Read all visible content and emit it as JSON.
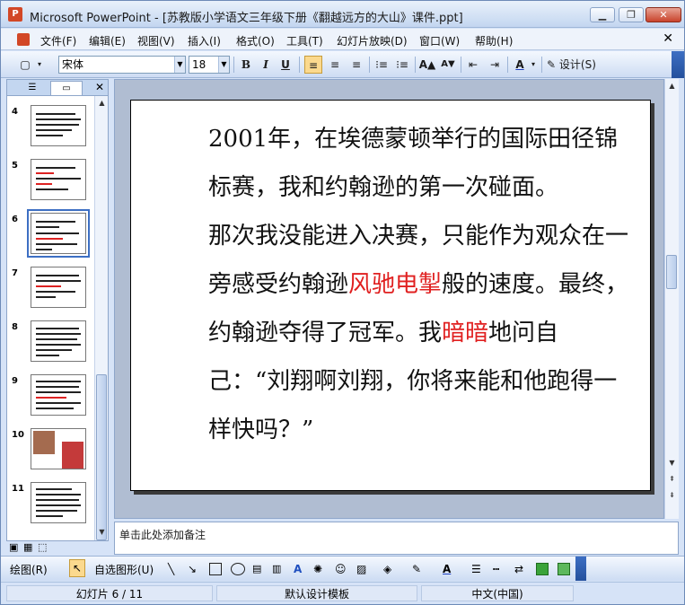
{
  "window": {
    "title": "Microsoft PowerPoint - [苏教版小学语文三年级下册《翻越远方的大山》课件.ppt]"
  },
  "menu": [
    "文件(F)",
    "编辑(E)",
    "视图(V)",
    "插入(I)",
    "格式(O)",
    "工具(T)",
    "幻灯片放映(D)",
    "窗口(W)",
    "帮助(H)"
  ],
  "toolbar": {
    "font": "宋体",
    "size": "18",
    "bold": "B",
    "italic": "I",
    "underline": "U",
    "font_color": "A",
    "design": "设计(S)"
  },
  "thumbnails": [
    "4",
    "5",
    "6",
    "7",
    "8",
    "9",
    "10",
    "11"
  ],
  "slide": {
    "p1": "2001年，在埃德蒙顿举行的国际田径锦标赛，我和约翰逊的第一次碰面。",
    "p2_a": "那次我没能进入决赛，只能作为观众在一旁感受约翰逊",
    "p2_hl1": "风驰电掣",
    "p2_b": "般的速度。最终，约翰逊夺得了冠军。我",
    "p2_hl2": "暗暗",
    "p2_c": "地问自己：“刘翔啊刘翔，你将来能和他跑得一样快吗？”"
  },
  "notes": {
    "placeholder": "单击此处添加备注"
  },
  "drawbar": {
    "draw": "绘图(R)",
    "autoshapes": "自选图形(U)",
    "font_color": "A"
  },
  "status": {
    "slide": "幻灯片 6 / 11",
    "template": "默认设计模板",
    "language": "中文(中国)"
  }
}
